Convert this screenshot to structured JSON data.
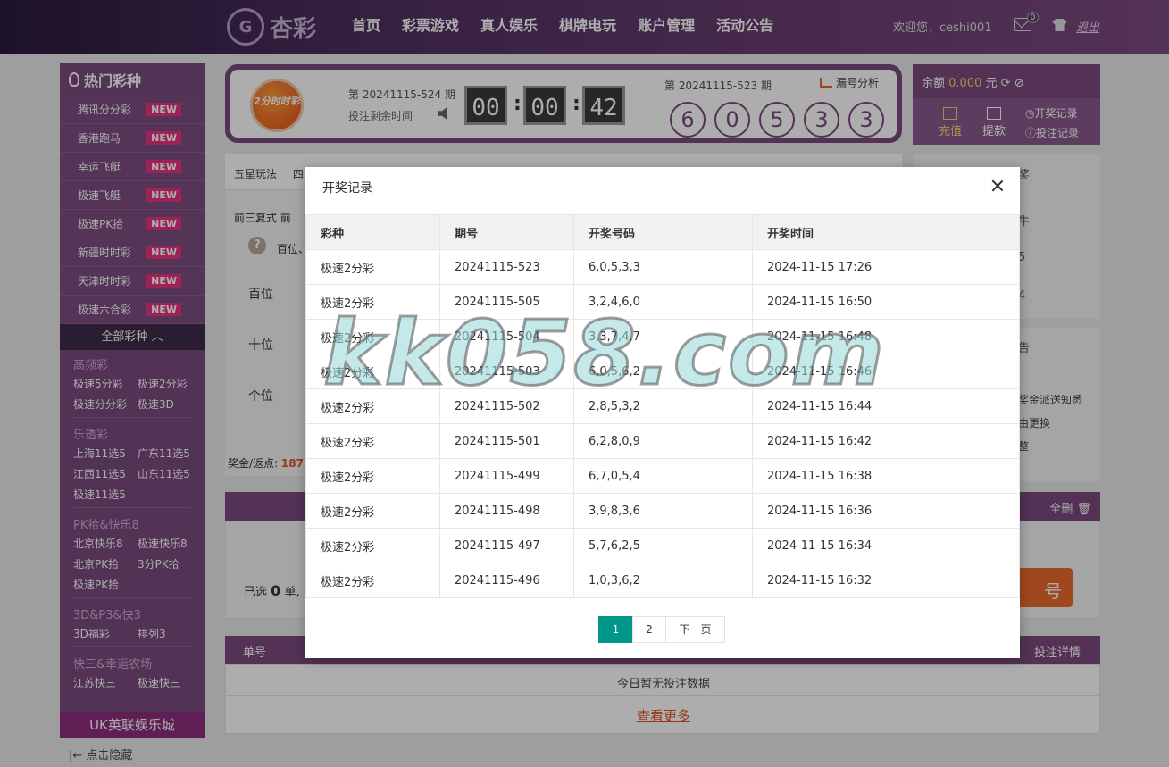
{
  "header": {
    "logo_text": "杏彩",
    "nav": [
      "首页",
      "彩票游戏",
      "真人娱乐",
      "棋牌电玩",
      "账户管理",
      "活动公告"
    ],
    "welcome": "欢迎您，ceshi001",
    "mail_count": "0",
    "logout": "退出"
  },
  "sidebar": {
    "title": "热门彩种",
    "hot": [
      {
        "name": "腾讯分分彩",
        "badge": "NEW"
      },
      {
        "name": "香港跑马",
        "badge": "NEW"
      },
      {
        "name": "幸运飞艇",
        "badge": "NEW"
      },
      {
        "name": "极速飞艇",
        "badge": "NEW"
      },
      {
        "name": "极速PK拾",
        "badge": "NEW"
      },
      {
        "name": "新疆时时彩",
        "badge": "NEW"
      },
      {
        "name": "天津时时彩",
        "badge": "NEW"
      },
      {
        "name": "极速六合彩",
        "badge": "NEW"
      }
    ],
    "all_label": "全部彩种",
    "categories": [
      {
        "title": "高频彩",
        "items": [
          "极速5分彩",
          "极速2分彩",
          "极速分分彩",
          "极速3D"
        ]
      },
      {
        "title": "乐透彩",
        "items": [
          "上海11选5",
          "广东11选5",
          "江西11选5",
          "山东11选5",
          "极速11选5"
        ]
      },
      {
        "title": "PK拾&快乐8",
        "items": [
          "北京快乐8",
          "极速快乐8",
          "北京PK拾",
          "3分PK拾",
          "极速PK拾"
        ]
      },
      {
        "title": "3D&P3&快3",
        "items": [
          "3D福彩",
          "排列3"
        ]
      },
      {
        "title": "快三&幸运农场",
        "items": [
          "江苏快三",
          "极速快三"
        ]
      }
    ],
    "uk_label": "UK英联娱乐城",
    "hide_label": "点击隐藏"
  },
  "lottery": {
    "ball_text": "2分时时彩",
    "issue": "第 20241115-524 期",
    "remain_label": "投注剩余时间",
    "timer": [
      "00",
      "00",
      "42"
    ],
    "prev_issue": "第 20241115-523 期",
    "trend_label": "漏号分析",
    "result": [
      "6",
      "0",
      "5",
      "3",
      "3"
    ]
  },
  "account": {
    "balance_label": "余额",
    "balance_value": "0.000",
    "balance_unit": "元",
    "recharge": "充值",
    "withdraw": "提款",
    "draw_record": "开奖记录",
    "bet_record": "投注记录"
  },
  "play": {
    "tab_first": "五星玩法",
    "tab_second": "四",
    "sub_first": "前三复式",
    "sub_second": "前",
    "hint": "百位、",
    "positions": [
      "百位",
      "十位",
      "个位"
    ],
    "bonus_label": "奖金/返点:",
    "bonus_value": "187",
    "chosen_prefix": "已选",
    "chosen_count": "0",
    "chosen_suffix": "单,",
    "orange_btn": "号",
    "clear_all": "全删",
    "side_top": "奖",
    "side_items": [
      "牛",
      "5",
      "4"
    ],
    "side2_title": "告",
    "side2_items": [
      "奖金派送知悉",
      "由更换",
      "整"
    ]
  },
  "records": {
    "col_first": "单号",
    "col_last": "投注详情",
    "empty": "今日暂无投注数据",
    "more": "查看更多"
  },
  "modal": {
    "title": "开奖记录",
    "columns": [
      "彩种",
      "期号",
      "开奖号码",
      "开奖时间"
    ],
    "rows": [
      [
        "极速2分彩",
        "20241115-523",
        "6,0,5,3,3",
        "2024-11-15 17:26"
      ],
      [
        "极速2分彩",
        "20241115-505",
        "3,2,4,6,0",
        "2024-11-15 16:50"
      ],
      [
        "极速2分彩",
        "20241115-504",
        "3,3,7,4,7",
        "2024-11-15 16:48"
      ],
      [
        "极速2分彩",
        "20241115-503",
        "6,0,5,6,2",
        "2024-11-15 16:46"
      ],
      [
        "极速2分彩",
        "20241115-502",
        "2,8,5,3,2",
        "2024-11-15 16:44"
      ],
      [
        "极速2分彩",
        "20241115-501",
        "6,2,8,0,9",
        "2024-11-15 16:42"
      ],
      [
        "极速2分彩",
        "20241115-499",
        "6,7,0,5,4",
        "2024-11-15 16:38"
      ],
      [
        "极速2分彩",
        "20241115-498",
        "3,9,8,3,6",
        "2024-11-15 16:36"
      ],
      [
        "极速2分彩",
        "20241115-497",
        "5,7,6,2,5",
        "2024-11-15 16:34"
      ],
      [
        "极速2分彩",
        "20241115-496",
        "1,0,3,6,2",
        "2024-11-15 16:32"
      ]
    ],
    "pager": [
      "1",
      "2",
      "下一页"
    ]
  },
  "watermark": "kk058.com"
}
